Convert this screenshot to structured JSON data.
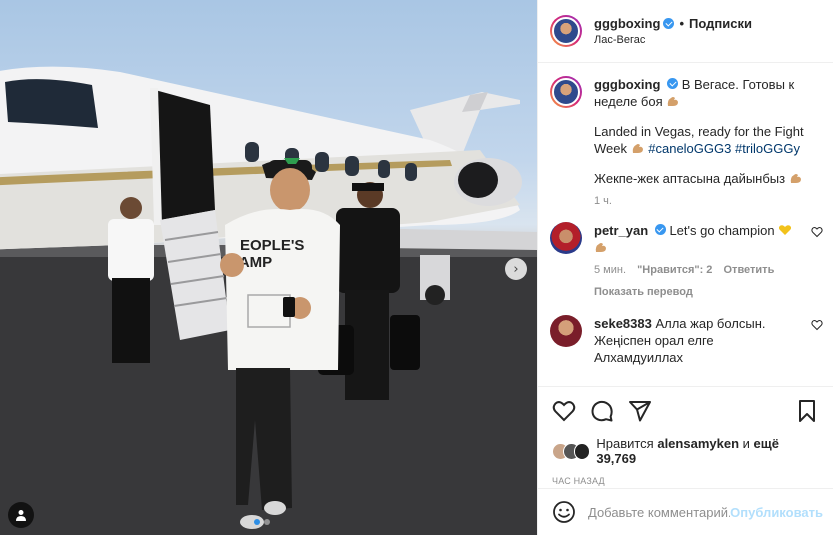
{
  "post": {
    "photo": {
      "description_icon": "photo",
      "next_glyph": "›",
      "dots": 2
    },
    "author": {
      "username": "gggboxing",
      "follow_label": "Подписки",
      "location": "Лас-Вегас",
      "dot": "•"
    },
    "caption": {
      "username": "gggboxing",
      "line1": "В Вегасе. Готовы к неделе боя",
      "line2": "Landed in Vegas, ready for the Fight Week",
      "hashtag1": "#caneloGGG3",
      "hashtag2": "#triloGGGy",
      "line3": "Жекпе-жек аптасына дайынбыз",
      "time": "1 ч."
    },
    "comments": [
      {
        "username": "petr_yan",
        "text": "Let's go champion",
        "time": "5 мин.",
        "likes": "\"Нравится\": 2",
        "reply": "Ответить",
        "translate": "Показать перевод"
      },
      {
        "username": "seke8383",
        "text": "Алла жар болсын. Жеңіспен орал елге Алхамдуиллах"
      }
    ],
    "likes_prefix": "Нравится",
    "likes_user": "alensamyken",
    "likes_and": "и",
    "likes_more": "ещё 39,769",
    "posted": "ЧАС НАЗАД",
    "comment_placeholder": "Добавьте комментарий...",
    "publish_label": "Опубликовать"
  },
  "icons": [
    "heart-icon",
    "comment-icon",
    "share-icon",
    "bookmark-icon",
    "emoji-icon",
    "tag-user-icon",
    "chevron-right-icon",
    "verified-icon"
  ],
  "colors": {
    "link": "#00376b",
    "verified": "#3897f0",
    "publish": "#b2dffc",
    "muted": "#8e8e8e",
    "active_dot": "#2d8ee5"
  }
}
